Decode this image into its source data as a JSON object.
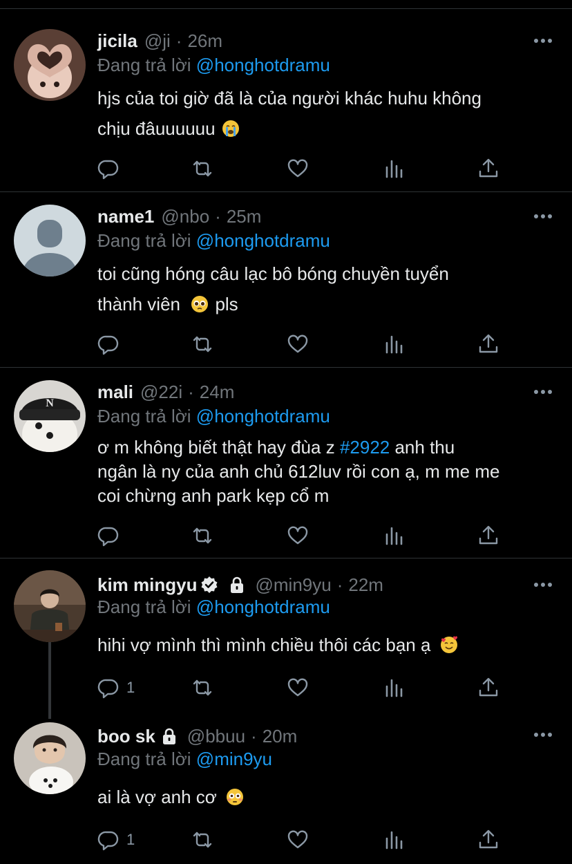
{
  "colors": {
    "background": "#000000",
    "divider": "#2f3336",
    "text": "#e7e9ea",
    "secondary": "#71767b",
    "link": "#1d9bf0",
    "icon": "#8b98a5"
  },
  "tweets": [
    {
      "name": "jicila",
      "handle": "@ji",
      "separator": "·",
      "time": "26m",
      "replying_prefix": "Đang trả lời",
      "replying_to": "@honghotdramu",
      "text_lines": [
        "hjs của toi giờ đã là của người khác huhu không",
        "chịu đâuuuuuu"
      ],
      "emoji": "loudly-crying-face-emoji",
      "avatar": "heart-hands-avatar",
      "reply_count": ""
    },
    {
      "name": "name1",
      "handle": "@nbo",
      "separator": "·",
      "time": "25m",
      "replying_prefix": "Đang trả lời",
      "replying_to": "@honghotdramu",
      "text_lines": [
        "toi cũng hóng câu lạc bô bóng chuyền tuyển",
        "thành viên"
      ],
      "text_suffix": " pls",
      "emoji": "pleading-face-emoji",
      "avatar": "default-avatar",
      "reply_count": ""
    },
    {
      "name": "mali",
      "handle": "@22i",
      "separator": "·",
      "time": "24m",
      "replying_prefix": "Đang trả lời",
      "replying_to": "@honghotdramu",
      "text_pre": "ơ m không biết thật hay đùa z ",
      "hashtag": "#2922",
      "text_post": " anh thu",
      "text_lines": [
        "ngân là ny của anh chủ 612luv rồi con ạ, m me me",
        "coi chừng anh park kẹp cổ m"
      ],
      "avatar": "dog-with-ny-beanie-avatar",
      "reply_count": ""
    },
    {
      "name": "kim mingyu",
      "handle": "@min9yu",
      "separator": "·",
      "time": "22m",
      "replying_prefix": "Đang trả lời",
      "replying_to": "@honghotdramu",
      "text": "hihi vợ mình thì mình chiều thôi các bạn ạ",
      "emoji": "smiling-face-with-hearts-emoji",
      "avatar": "man-at-table-avatar",
      "reply_count": "1"
    },
    {
      "name": "boo sk",
      "handle": "@bbuu",
      "separator": "·",
      "time": "20m",
      "replying_prefix": "Đang trả lời",
      "replying_to": "@min9yu",
      "text": "ai là vợ anh cơ",
      "emoji": "flushed-face-emoji",
      "avatar": "man-with-white-dog-avatar",
      "reply_count": "1"
    }
  ]
}
